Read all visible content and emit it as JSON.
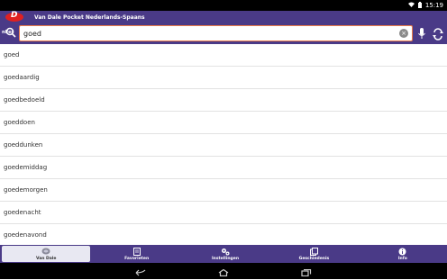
{
  "status_bar": {
    "time": "15:19"
  },
  "app": {
    "title": "Van Dale Pocket Nederlands-Spaans",
    "logo_letter": "D"
  },
  "search": {
    "lang_code": "nl/es",
    "value": "goed",
    "placeholder": ""
  },
  "words": [
    "goed",
    "goedaardig",
    "goedbedoeld",
    "goeddoen",
    "goeddunken",
    "goedemiddag",
    "goedemorgen",
    "goedenacht",
    "goedenavond"
  ],
  "bottom_nav": [
    {
      "label": "Van Dale",
      "icon": "van-dale-icon",
      "active": true
    },
    {
      "label": "Favorieten",
      "icon": "favorites-icon",
      "active": false
    },
    {
      "label": "Instellingen",
      "icon": "settings-icon",
      "active": false
    },
    {
      "label": "Geschiedenis",
      "icon": "history-icon",
      "active": false
    },
    {
      "label": "Info",
      "icon": "info-icon",
      "active": false
    }
  ],
  "colors": {
    "primary": "#4a3a87",
    "accent": "#e8794a",
    "logo_red": "#e02020"
  }
}
